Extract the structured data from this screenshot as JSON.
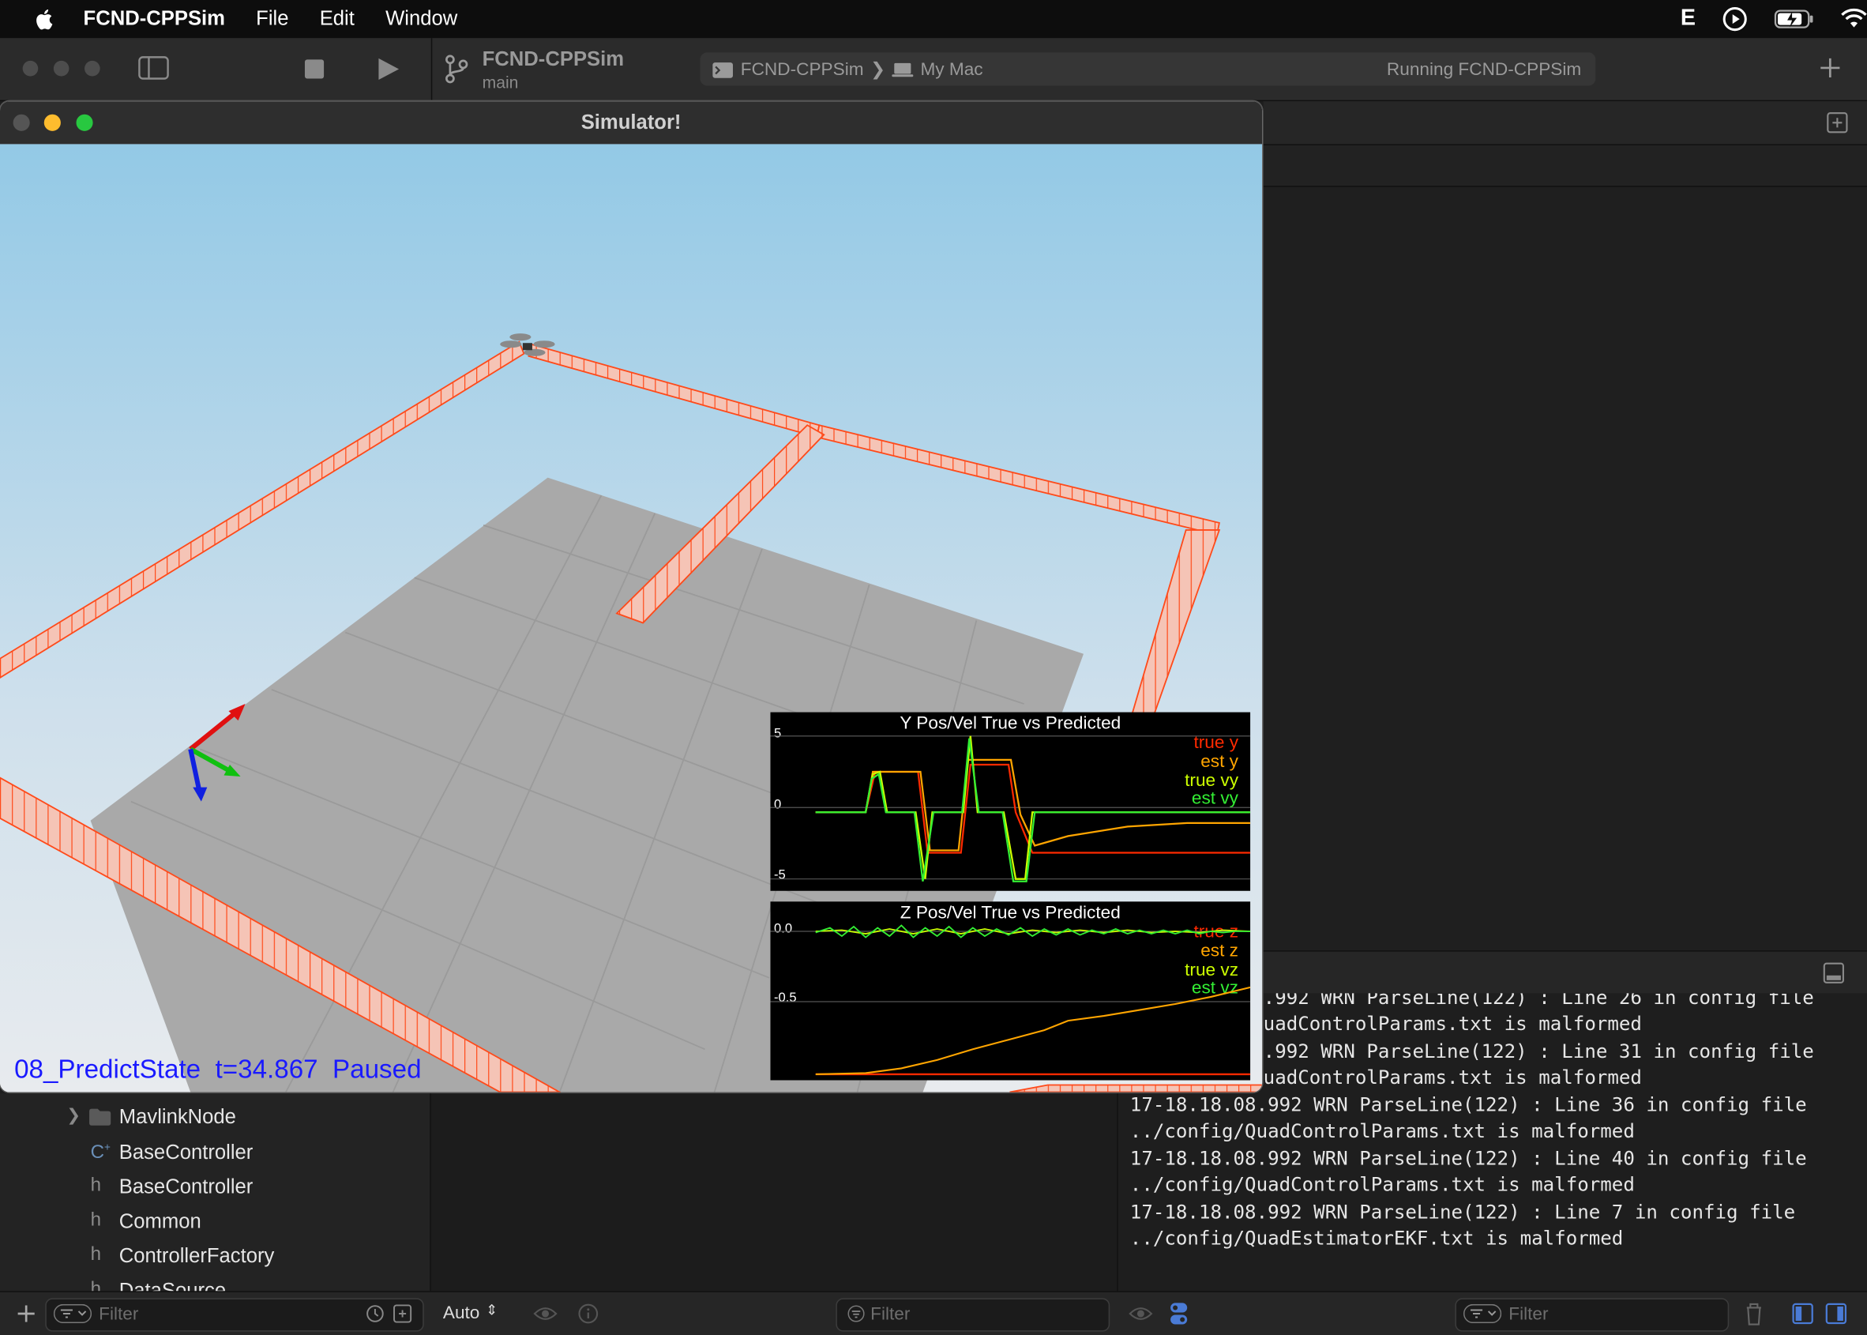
{
  "menubar": {
    "app": "FCND-CPPSim",
    "items": [
      "File",
      "Edit",
      "Window"
    ],
    "status_letter": "E"
  },
  "toolbar": {
    "project": "FCND-CPPSim",
    "branch": "main",
    "scheme": "FCND-CPPSim",
    "destination": "My Mac",
    "status": "Running FCND-CPPSim"
  },
  "simulator": {
    "title": "Simulator!",
    "status": "08_PredictState  t=34.867  Paused"
  },
  "plot_y": {
    "title": "Y Pos/Vel True vs Predicted",
    "yticks": [
      "5",
      "0",
      "-5"
    ],
    "legend": [
      {
        "label": "true y",
        "color": "#ff2a00"
      },
      {
        "label": "est y",
        "color": "#ffa500"
      },
      {
        "label": "true vy",
        "color": "#ccff00"
      },
      {
        "label": "est vy",
        "color": "#33ee33"
      }
    ]
  },
  "plot_z": {
    "title": "Z Pos/Vel True vs Predicted",
    "yticks": [
      "0.0",
      "-0.5"
    ],
    "legend": [
      {
        "label": "true z",
        "color": "#ff2a00"
      },
      {
        "label": "est z",
        "color": "#ffa500"
      },
      {
        "label": "true vz",
        "color": "#ccff00"
      },
      {
        "label": "est vz",
        "color": "#33ee33"
      }
    ]
  },
  "console": {
    "lines": [
      ".992 WRN ParseLine(122) : Line 26 in config file",
      "uadControlParams.txt is malformed",
      ".992 WRN ParseLine(122) : Line 31 in config file",
      "uadControlParams.txt is malformed",
      "17-18.18.08.992 WRN ParseLine(122) : Line 36 in config file",
      "../config/QuadControlParams.txt is malformed",
      "17-18.18.08.992 WRN ParseLine(122) : Line 40 in config file",
      "../config/QuadControlParams.txt is malformed",
      "17-18.18.08.992 WRN ParseLine(122) : Line 7 in config file",
      "../config/QuadEstimatorEKF.txt is malformed"
    ]
  },
  "navigator": {
    "items": [
      {
        "icon": "folder-icon",
        "label": "MavlinkNode"
      },
      {
        "icon": "c++-file-icon",
        "label": "BaseController"
      },
      {
        "icon": "header-file-icon",
        "label": "BaseController"
      },
      {
        "icon": "header-file-icon",
        "label": "Common"
      },
      {
        "icon": "header-file-icon",
        "label": "ControllerFactory"
      },
      {
        "icon": "header-file-icon",
        "label": "DataSource"
      }
    ]
  },
  "bottombar": {
    "nav_filter_placeholder": "Filter",
    "auto_label": "Auto",
    "debug_filter_placeholder": "Filter",
    "console_filter_placeholder": "Filter"
  }
}
